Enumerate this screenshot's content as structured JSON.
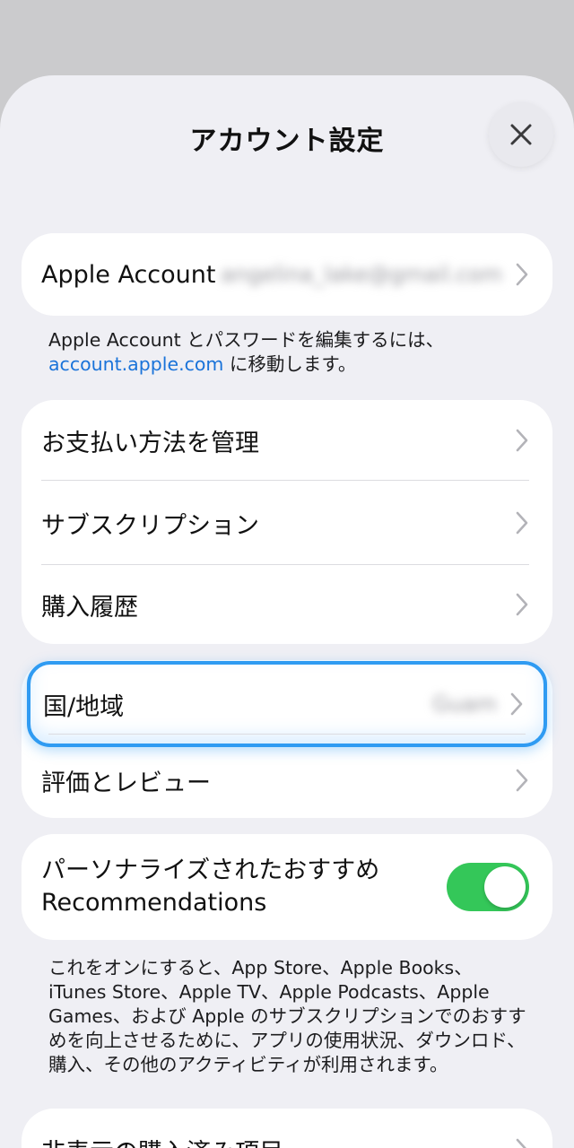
{
  "sheet": {
    "title": "アカウント設定",
    "close_icon": "close-icon"
  },
  "apple_account": {
    "label": "Apple Account",
    "value": "angelina_lake@gmail.com"
  },
  "apple_account_note": {
    "line1": "Apple Account とパスワードを編集するには、",
    "link": "account.apple.com",
    "line2_rest": " に移動します。"
  },
  "group1": {
    "items": [
      {
        "label": "お支払い方法を管理"
      },
      {
        "label": "サブスクリプション"
      },
      {
        "label": "購入履歴"
      }
    ]
  },
  "group2": {
    "items": [
      {
        "label": "国/地域",
        "value": "Guam"
      },
      {
        "label": "評価とレビュー"
      }
    ]
  },
  "personalized": {
    "label_line1": "パーソナライズされたおすすめ",
    "label_line2": "Recommendations",
    "toggle_on": true
  },
  "personalized_note": {
    "text": "これをオンにすると、App Store、Apple Books、iTunes Store、Apple TV、Apple Podcasts、Apple Games、および Apple のサブスクリプションでのおすすめを向上させるために、アプリの使用状況、ダウンロド、購入、その他のアクティビティが利用されます。"
  },
  "hidden_purchases": {
    "label": "非表示の購入済み項目"
  },
  "colors": {
    "accent": "#1a73d9",
    "toggle_on": "#34c759",
    "highlight": "#2f9bf2"
  }
}
